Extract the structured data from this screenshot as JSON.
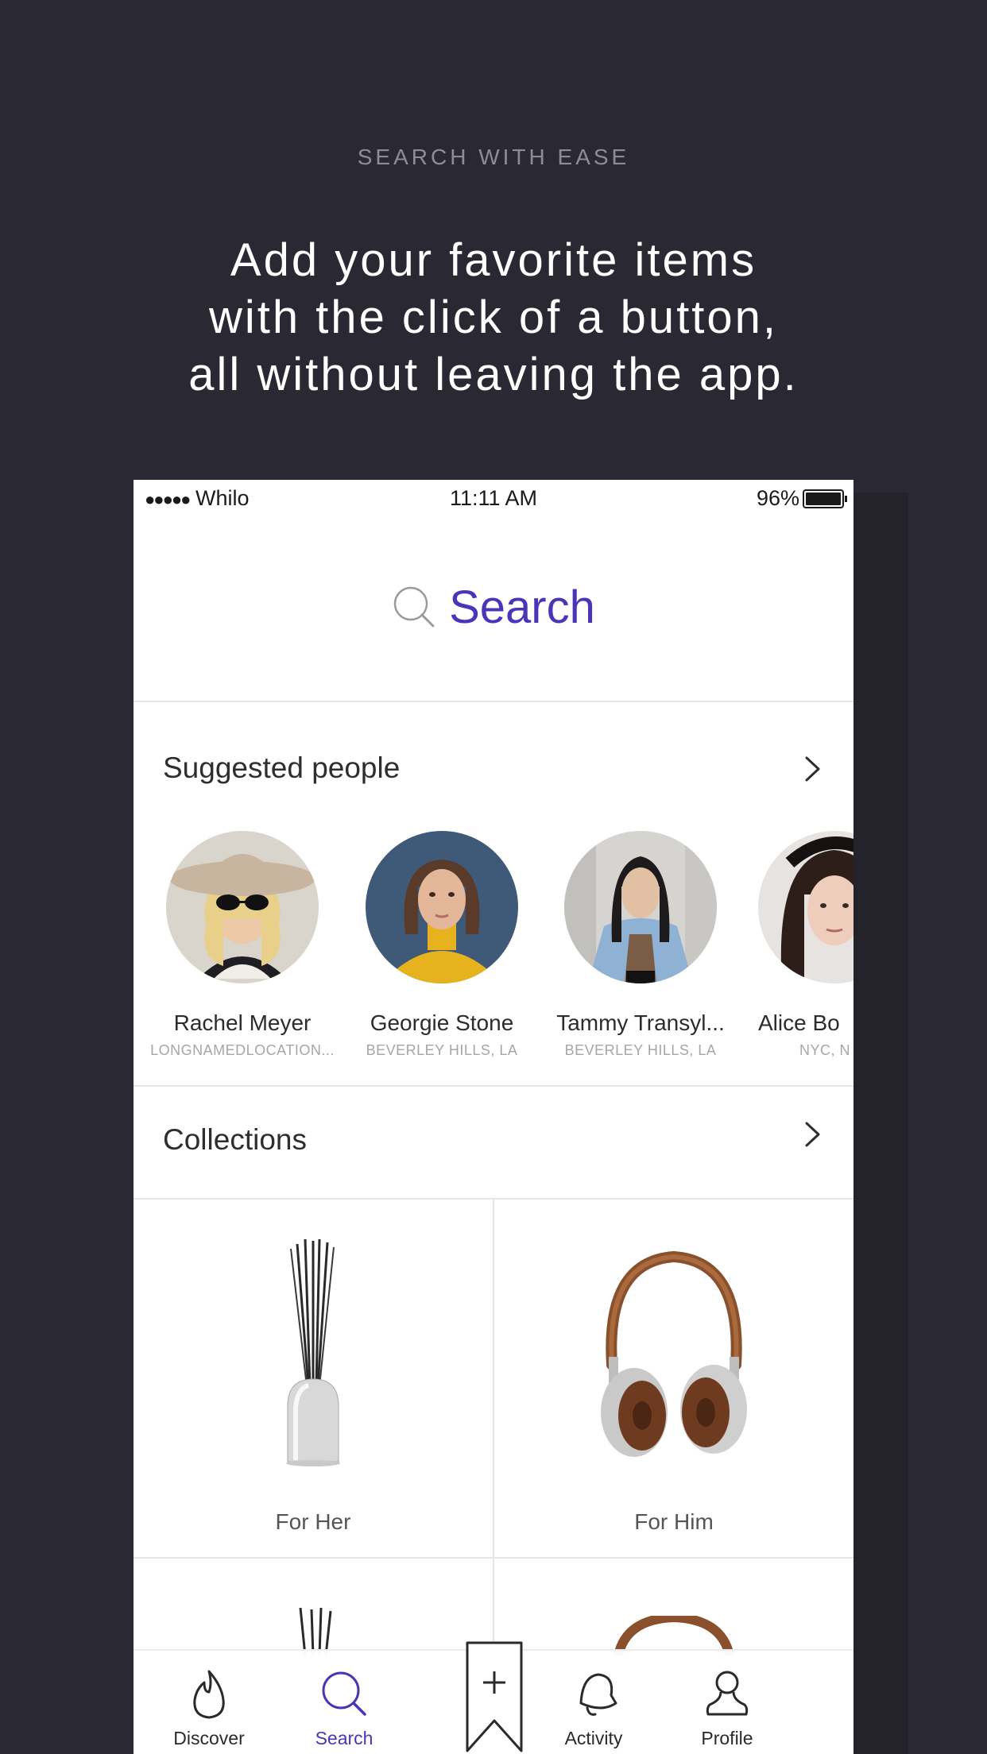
{
  "promo": {
    "eyebrow": "SEARCH WITH EASE",
    "headline_lines": [
      "Add your favorite items",
      "with the click of a button,",
      "all without leaving the app."
    ]
  },
  "status_bar": {
    "signal": "●●●●●",
    "carrier": "Whilo",
    "time": "11:11 AM",
    "battery_percent": "96%"
  },
  "search": {
    "icon": "search-icon",
    "label": "Search"
  },
  "suggested_people": {
    "title": "Suggested people",
    "more_icon": "chevron-right-icon",
    "people": [
      {
        "name": "Rachel Meyer",
        "location": "LONGNAMEDLOCATION..."
      },
      {
        "name": "Georgie Stone",
        "location": "BEVERLEY HILLS, LA"
      },
      {
        "name": "Tammy Transyl...",
        "location": "BEVERLEY HILLS, LA"
      },
      {
        "name": "Alice Bo",
        "location": "NYC, N"
      }
    ]
  },
  "collections": {
    "title": "Collections",
    "more_icon": "chevron-right-icon",
    "items": [
      {
        "label": "For Her",
        "icon": "diffuser-image"
      },
      {
        "label": "For Him",
        "icon": "headphones-image"
      }
    ]
  },
  "tab_bar": {
    "active": "Search",
    "tabs": [
      {
        "label": "Discover",
        "icon": "flame-icon"
      },
      {
        "label": "Search",
        "icon": "search-icon"
      },
      {
        "label": "Activity",
        "icon": "bell-icon"
      },
      {
        "label": "Profile",
        "icon": "person-icon"
      }
    ],
    "center_button_icon": "bookmark-add-icon"
  },
  "colors": {
    "background": "#2a2833",
    "accent": "#4a35b8",
    "text_dark": "#2e2e2e",
    "text_muted": "#a6a6a6"
  }
}
